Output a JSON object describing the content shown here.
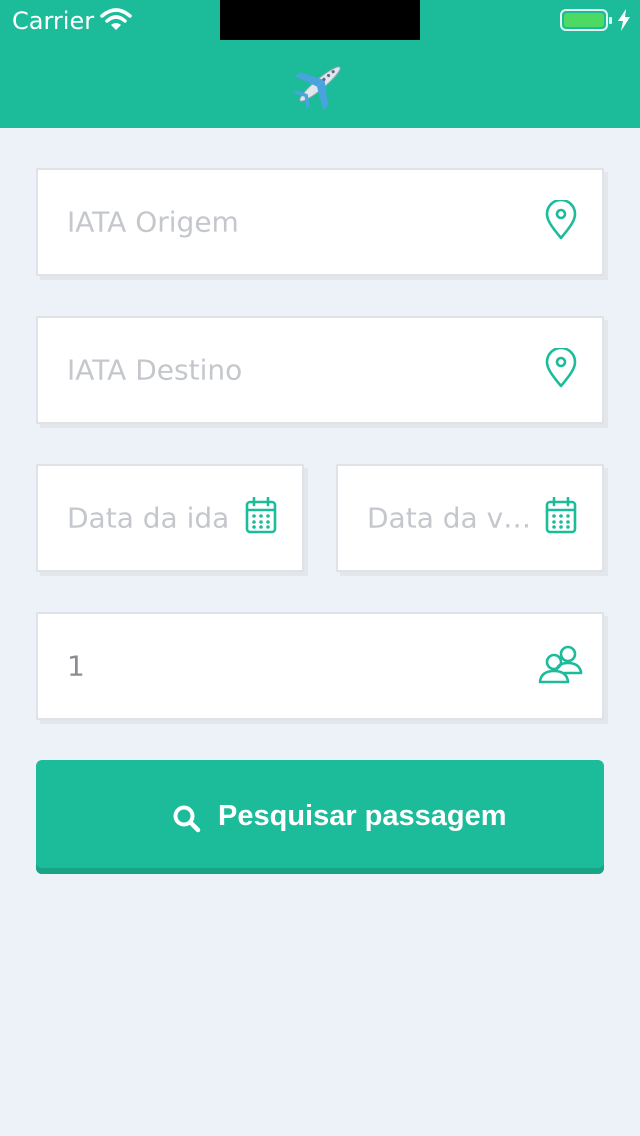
{
  "status_bar": {
    "carrier": "Carrier",
    "icons": [
      "wifi-icon",
      "battery-icon",
      "charging-bolt-icon"
    ]
  },
  "header": {
    "logo_icon": "airplane-icon"
  },
  "form": {
    "origin": {
      "placeholder": "IATA Origem",
      "value": "",
      "icon": "location-pin-icon"
    },
    "destination": {
      "placeholder": "IATA Destino",
      "value": "",
      "icon": "location-pin-icon"
    },
    "departure_date": {
      "placeholder": "Data da ida",
      "value": "",
      "icon": "calendar-icon"
    },
    "return_date": {
      "placeholder": "Data da volta",
      "value": "",
      "icon": "calendar-icon"
    },
    "passengers": {
      "value": "1",
      "icon": "users-icon"
    }
  },
  "search_button": {
    "label": "Pesquisar passagem",
    "icon": "search-icon"
  },
  "colors": {
    "accent": "#1cbc9b",
    "background": "#edf1f8",
    "placeholder": "#c4c7cc"
  }
}
